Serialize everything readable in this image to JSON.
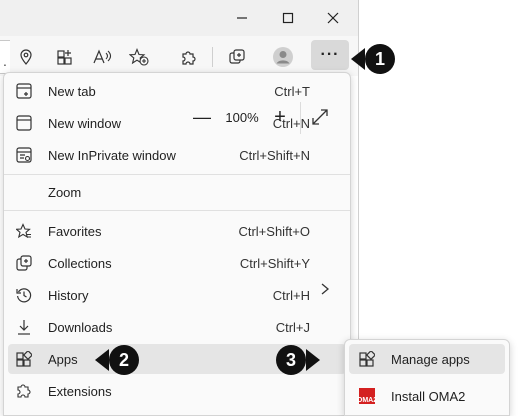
{
  "toolbar": {
    "more_label": "···",
    "icons": [
      "location-pin-icon",
      "apps-add-icon",
      "read-aloud-icon",
      "favorite-add-icon",
      "extensions-icon",
      "collections-icon",
      "profile-avatar-icon"
    ]
  },
  "window": {
    "minimize": "minimize-icon",
    "maximize": "maximize-icon",
    "close": "close-icon"
  },
  "menu": {
    "new_tab": {
      "label": "New tab",
      "shortcut": "Ctrl+T"
    },
    "new_window": {
      "label": "New window",
      "shortcut": "Ctrl+N"
    },
    "new_inprivate": {
      "label": "New InPrivate window",
      "shortcut": "Ctrl+Shift+N"
    },
    "zoom": {
      "label": "Zoom",
      "minus": "—",
      "value": "100%",
      "plus": "+"
    },
    "favorites": {
      "label": "Favorites",
      "shortcut": "Ctrl+Shift+O"
    },
    "collections": {
      "label": "Collections",
      "shortcut": "Ctrl+Shift+Y"
    },
    "history": {
      "label": "History",
      "shortcut": "Ctrl+H"
    },
    "downloads": {
      "label": "Downloads",
      "shortcut": "Ctrl+J"
    },
    "apps": {
      "label": "Apps"
    },
    "extensions": {
      "label": "Extensions"
    }
  },
  "submenu": {
    "manage_apps": {
      "label": "Manage apps"
    },
    "install_app": {
      "label": "Install OMA2",
      "icon_text": "OMA2"
    }
  },
  "callouts": {
    "one": "1",
    "two": "2",
    "three": "3"
  },
  "colors": {
    "menu_bg": "#fafafa",
    "hover_bg": "#e5e5e5",
    "callout": "#111111",
    "oma_red": "#d42020"
  }
}
